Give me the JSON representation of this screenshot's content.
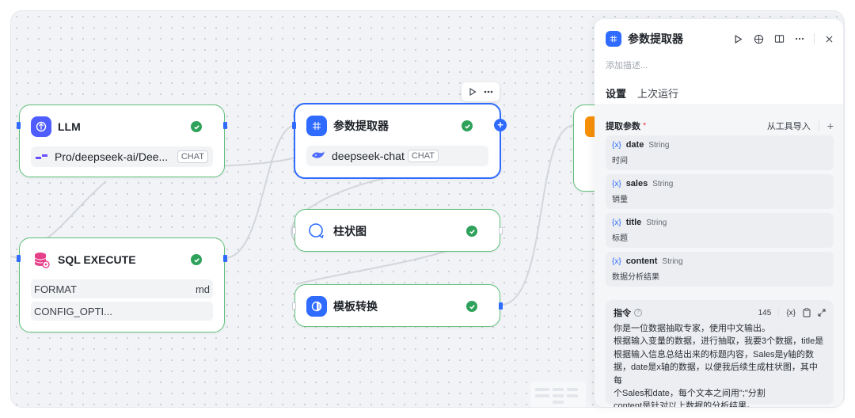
{
  "colors": {
    "accent": "#2f6bff",
    "success": "#2ea15a",
    "node_border": "#5fc07c",
    "llm_icon": "#4f5dff",
    "sql_icon": "#e6408a",
    "panel_icon": "#2f6bff"
  },
  "nodes": {
    "llm": {
      "title": "LLM",
      "icon": "llm-icon",
      "model": "Pro/deepseek-ai/Dee...",
      "badge": "CHAT"
    },
    "sql": {
      "title": "SQL EXECUTE",
      "icon": "database-icon",
      "params": [
        {
          "label": "FORMAT",
          "value": "md"
        },
        {
          "label": "CONFIG_OPTI...",
          "value": ""
        }
      ]
    },
    "extractor": {
      "title": "参数提取器",
      "icon": "grid-icon",
      "model": "deepseek-chat",
      "badge": "CHAT"
    },
    "bar_chart": {
      "title": "柱状图",
      "icon": "chart-icon"
    },
    "template": {
      "title": "模板转换",
      "icon": "template-icon"
    }
  },
  "panel": {
    "title": "参数提取器",
    "description_placeholder": "添加描述...",
    "tabs": [
      {
        "label": "设置",
        "active": true
      },
      {
        "label": "上次运行",
        "active": false
      }
    ],
    "extract_section": {
      "label": "提取参数",
      "required_mark": "*",
      "import_label": "从工具导入",
      "add_label": "+"
    },
    "params": [
      {
        "var": "{x}",
        "name": "date",
        "type": "String",
        "desc": "时间"
      },
      {
        "var": "{x}",
        "name": "sales",
        "type": "String",
        "desc": "销量"
      },
      {
        "var": "{x}",
        "name": "title",
        "type": "String",
        "desc": "标题"
      },
      {
        "var": "{x}",
        "name": "content",
        "type": "String",
        "desc": "数据分析结果"
      }
    ],
    "prompt": {
      "label": "指令",
      "help": "?",
      "count": "145",
      "var_label": "{x}",
      "lines": [
        "你是一位数据抽取专家，使用中文输出。",
        "根据输入变量的数据，进行抽取，我要3个数据，title是",
        "根据输入信息总结出来的标题内容，Sales是y轴的数",
        "据，date是x轴的数据，以便我后续生成柱状图，其中每",
        "个Sales和date，每个文本之间用\";\"分割",
        "content是针对以上数据的分析结果。"
      ]
    }
  }
}
